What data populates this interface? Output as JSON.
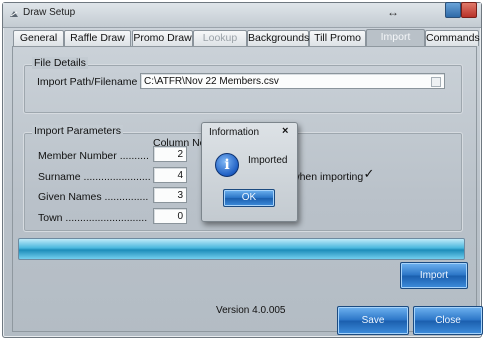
{
  "window": {
    "title": "Draw Setup",
    "resize_icon": "↔"
  },
  "tabs": [
    {
      "label": "General"
    },
    {
      "label": "Raffle Draw"
    },
    {
      "label": "Promo Draw"
    },
    {
      "label": "Lookup"
    },
    {
      "label": "Backgrounds"
    },
    {
      "label": "Till Promo"
    },
    {
      "label": "Import"
    },
    {
      "label": "Commands"
    }
  ],
  "active_tab": "Import",
  "file_details": {
    "group_title": "File Details",
    "path_label": "Import Path/Filename",
    "path_value": "C:\\ATFR\\Nov 22 Members.csv"
  },
  "import_parameters": {
    "group_title": "Import Parameters",
    "column_header": "Column No",
    "fields": [
      {
        "label": "Member Number ..........",
        "value": "2"
      },
      {
        "label": "Surname .......................",
        "value": "4"
      },
      {
        "label": "Given Names ...............",
        "value": "3"
      },
      {
        "label": "Town ............................",
        "value": "0"
      }
    ],
    "option_text": "when importing",
    "option_checked": true,
    "check_mark": "✓"
  },
  "progress": {
    "fraction": 1.0
  },
  "buttons": {
    "import": "Import",
    "save": "Save",
    "close": "Close"
  },
  "version": "Version 4.0.005",
  "dialog": {
    "title": "Information",
    "close_glyph": "×",
    "icon": "info-icon",
    "icon_glyph": "i",
    "message": "Imported",
    "ok": "OK"
  }
}
